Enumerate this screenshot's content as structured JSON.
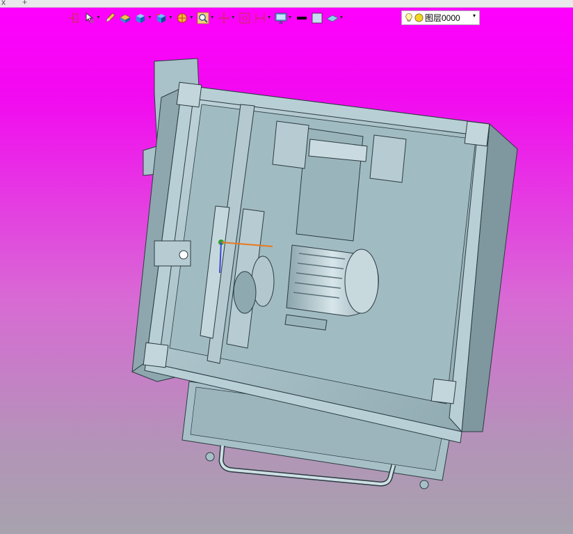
{
  "tabs": {
    "close_glyph": "x",
    "add_glyph": "+"
  },
  "toolbar": {
    "tools": [
      {
        "name": "exit-sketch-icon",
        "dropdown": false
      },
      {
        "name": "select-filter-icon",
        "dropdown": true
      },
      {
        "name": "pencil-icon",
        "dropdown": false
      },
      {
        "name": "render-mode-icon",
        "dropdown": false
      },
      {
        "name": "cube-view-icon",
        "dropdown": true
      },
      {
        "name": "orientation-icon",
        "dropdown": true
      },
      {
        "name": "section-view-icon",
        "dropdown": true
      },
      {
        "name": "zoom-icon",
        "dropdown": true
      },
      {
        "name": "pan-icon",
        "dropdown": true
      },
      {
        "name": "fit-view-icon",
        "dropdown": false
      },
      {
        "name": "dimension-icon",
        "dropdown": true
      },
      {
        "name": "display-icon",
        "dropdown": true
      }
    ],
    "line_color": "#000000",
    "fill_color": "#c7dcf2",
    "layer": {
      "icon": "lightbulb-icon",
      "status_icon": "layer-dot-icon",
      "value": "图层0000",
      "arrow": "▾"
    }
  },
  "viewport": {
    "background_top": "#ff00ff",
    "background_bottom": "#a7a2ad",
    "model_color": "#a9c2c9"
  }
}
